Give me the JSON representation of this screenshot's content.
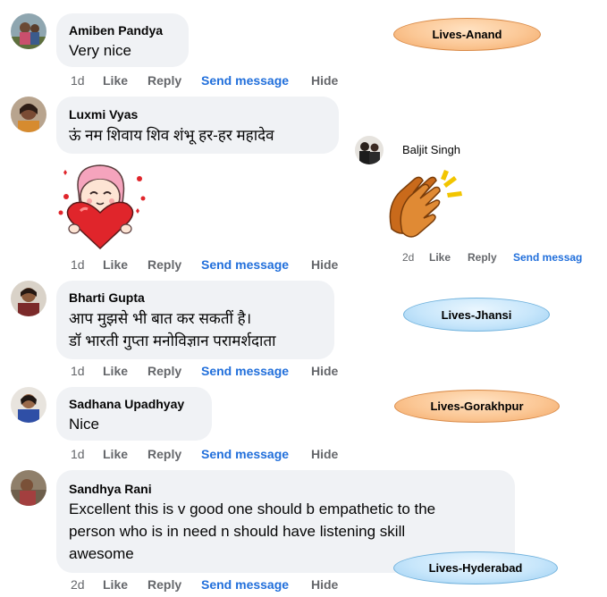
{
  "tags": {
    "anand": "Lives-Anand",
    "jhansi": "Lives-Jhansi",
    "gorakhpur": "Lives-Gorakhpur",
    "hyderabad": "Lives-Hyderabad"
  },
  "comments": [
    {
      "name": "Amiben Pandya",
      "lines": [
        "Very nice"
      ],
      "age": "1d",
      "like": "Like",
      "reply": "Reply",
      "send": "Send message",
      "hide": "Hide"
    },
    {
      "name": "Luxmi Vyas",
      "lines": [
        "ऊं नम शिवाय शिव शंभू हर-हर महादेव"
      ],
      "age": "1d",
      "like": "Like",
      "reply": "Reply",
      "send": "Send message",
      "hide": "Hide",
      "sticker": "heart-hug-sticker"
    },
    {
      "name": "Bharti Gupta",
      "lines": [
        "आप मुझसे भी बात कर सकतीं है।",
        "डॉ भारती गुप्ता मनोविज्ञान परामर्शदाता"
      ],
      "age": "1d",
      "like": "Like",
      "reply": "Reply",
      "send": "Send message",
      "hide": "Hide"
    },
    {
      "name": "Sadhana Upadhyay",
      "lines": [
        "Nice"
      ],
      "age": "1d",
      "like": "Like",
      "reply": "Reply",
      "send": "Send message",
      "hide": "Hide"
    },
    {
      "name": "Sandhya Rani",
      "lines": [
        "Excellent this is v good one should b empathetic to the",
        "person who is in need n should have listening skill",
        "awesome"
      ],
      "age": "2d",
      "like": "Like",
      "reply": "Reply",
      "send": "Send message",
      "hide": "Hide"
    }
  ],
  "side_comment": {
    "name": "Baljit Singh",
    "sticker": "clapping-hands-sticker",
    "age": "2d",
    "like": "Like",
    "reply": "Reply",
    "send": "Send messag"
  },
  "colors": {
    "link": "#216fdb",
    "muted": "#65676b",
    "bubble": "#f0f2f5"
  }
}
